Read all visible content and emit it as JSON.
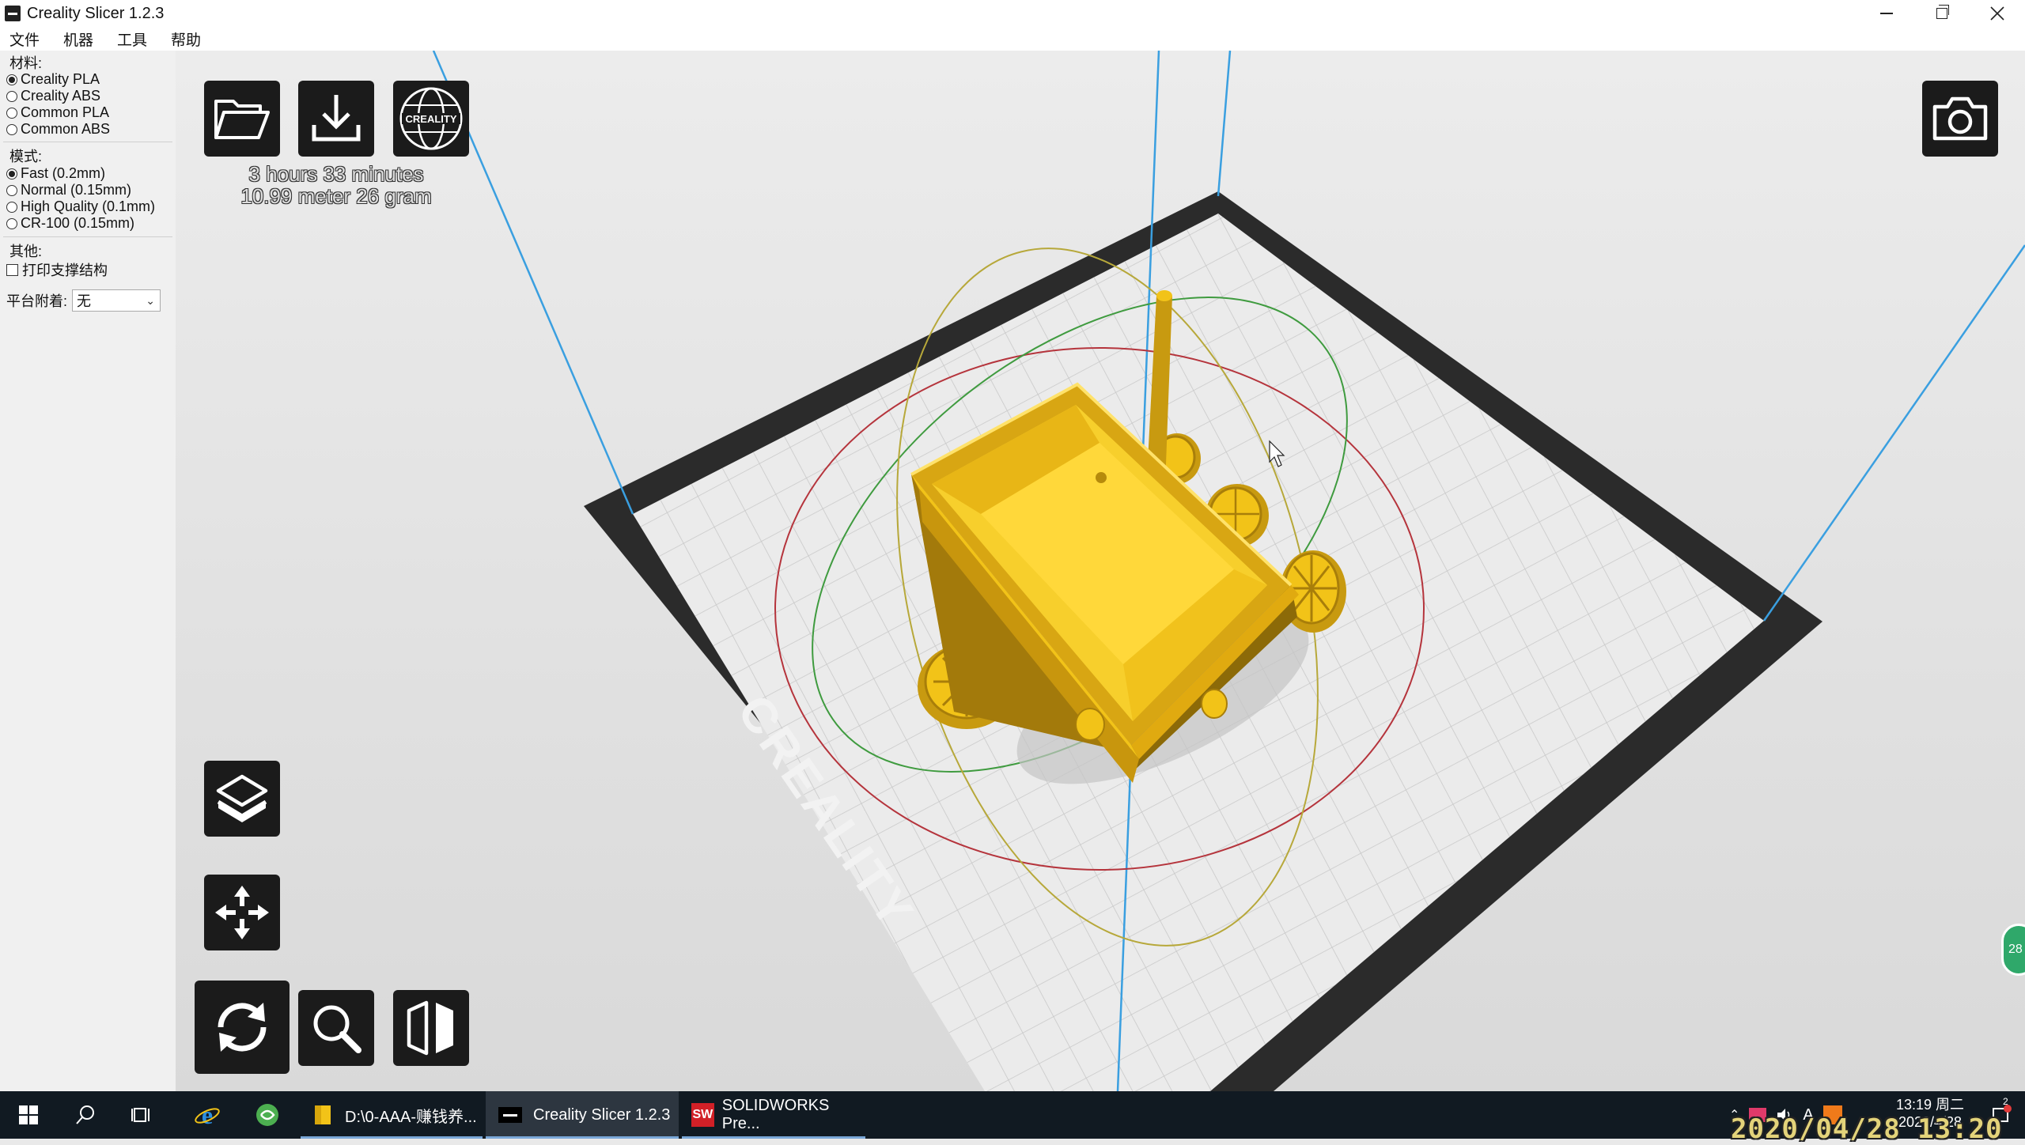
{
  "window": {
    "title": "Creality Slicer 1.2.3"
  },
  "menu": [
    "文件",
    "机器",
    "工具",
    "帮助"
  ],
  "sidebar": {
    "material_label": "材料:",
    "materials": [
      {
        "label": "Creality PLA",
        "selected": true
      },
      {
        "label": "Creality ABS",
        "selected": false
      },
      {
        "label": "Common PLA",
        "selected": false
      },
      {
        "label": "Common ABS",
        "selected": false
      }
    ],
    "mode_label": "模式:",
    "modes": [
      {
        "label": "Fast (0.2mm)",
        "selected": true
      },
      {
        "label": "Normal (0.15mm)",
        "selected": false
      },
      {
        "label": "High Quality (0.1mm)",
        "selected": false
      },
      {
        "label": "CR-100 (0.15mm)",
        "selected": false
      }
    ],
    "other_label": "其他:",
    "support_label": "打印支撑结构",
    "support_checked": false,
    "adhesion_label": "平台附着:",
    "adhesion_value": "无"
  },
  "print_info": {
    "time": "3 hours 33 minutes",
    "material": "10.99 meter 26 gram"
  },
  "bed_brand": "CREALITY",
  "toolbar_icons": {
    "open": "folder-open-icon",
    "save": "download-icon",
    "web": "creality-globe-icon",
    "snapshot": "camera-icon",
    "layers": "layers-icon",
    "move": "move-arrows-icon",
    "rotate": "rotate-icon",
    "scale": "zoom-icon",
    "mirror": "mirror-icon"
  },
  "model_color": "#f2c318",
  "badge_text": "28",
  "taskbar": {
    "apps": [
      {
        "label": "D:\\0-AAA-赚钱养...",
        "active": false
      },
      {
        "label": "Creality Slicer 1.2.3",
        "active": true
      },
      {
        "label": "SOLIDWORKS Pre...",
        "active": false
      }
    ],
    "ime": "A",
    "clock_time": "13:19 周二",
    "clock_date": "2020/4/28",
    "notification_count": "2"
  },
  "overlay_datetime": "2020/04/28 13:20"
}
